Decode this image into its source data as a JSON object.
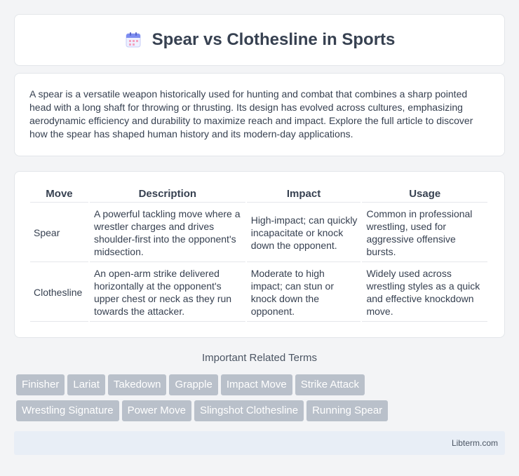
{
  "header": {
    "title": "Spear vs Clothesline in Sports",
    "icon": "calendar-icon"
  },
  "intro": {
    "text": "A spear is a versatile weapon historically used for hunting and combat that combines a sharp pointed head with a long shaft for throwing or thrusting. Its design has evolved across cultures, emphasizing aerodynamic efficiency and durability to maximize reach and impact. Explore the full article to discover how the spear has shaped human history and its modern-day applications."
  },
  "table": {
    "headers": [
      "Move",
      "Description",
      "Impact",
      "Usage"
    ],
    "rows": [
      {
        "move": "Spear",
        "description": "A powerful tackling move where a wrestler charges and drives shoulder-first into the opponent's midsection.",
        "impact": "High-impact; can quickly incapacitate or knock down the opponent.",
        "usage": "Common in professional wrestling, used for aggressive offensive bursts."
      },
      {
        "move": "Clothesline",
        "description": "An open-arm strike delivered horizontally at the opponent's upper chest or neck as they run towards the attacker.",
        "impact": "Moderate to high impact; can stun or knock down the opponent.",
        "usage": "Widely used across wrestling styles as a quick and effective knockdown move."
      }
    ]
  },
  "related": {
    "title": "Important Related Terms",
    "tags": [
      "Finisher",
      "Lariat",
      "Takedown",
      "Grapple",
      "Impact Move",
      "Strike Attack",
      "Wrestling Signature",
      "Power Move",
      "Slingshot Clothesline",
      "Running Spear"
    ]
  },
  "footer": {
    "site": "Libterm.com"
  },
  "colors": {
    "tag_bg": "#b9c0ca",
    "footer_bg": "#e8eef6"
  }
}
